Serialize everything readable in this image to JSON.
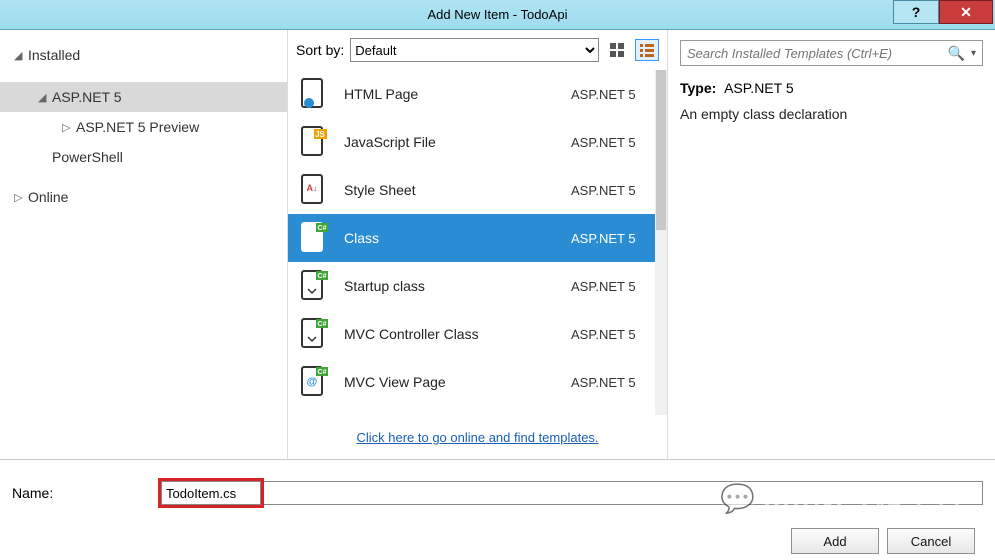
{
  "window": {
    "title": "Add New Item - TodoApi"
  },
  "left": {
    "installed": "Installed",
    "aspnet5": "ASP.NET 5",
    "aspnet5preview": "ASP.NET 5 Preview",
    "powershell": "PowerShell",
    "online": "Online"
  },
  "center": {
    "sort_label": "Sort by:",
    "sort_value": "Default",
    "templates": [
      {
        "label": "HTML Page",
        "cat": "ASP.NET 5",
        "icon": "html"
      },
      {
        "label": "JavaScript File",
        "cat": "ASP.NET 5",
        "icon": "js"
      },
      {
        "label": "Style Sheet",
        "cat": "ASP.NET 5",
        "icon": "css"
      },
      {
        "label": "Class",
        "cat": "ASP.NET 5",
        "icon": "cs",
        "selected": true
      },
      {
        "label": "Startup class",
        "cat": "ASP.NET 5",
        "icon": "cs"
      },
      {
        "label": "MVC Controller Class",
        "cat": "ASP.NET 5",
        "icon": "cs"
      },
      {
        "label": "MVC View Page",
        "cat": "ASP.NET 5",
        "icon": "view"
      }
    ],
    "online_link": "Click here to go online and find templates."
  },
  "right": {
    "search_placeholder": "Search Installed Templates (Ctrl+E)",
    "type_label": "Type:",
    "type_value": "ASP.NET 5",
    "description": "An empty class declaration"
  },
  "bottom": {
    "name_label": "Name:",
    "name_value": "TodoItem.cs",
    "add": "Add",
    "cancel": "Cancel"
  }
}
